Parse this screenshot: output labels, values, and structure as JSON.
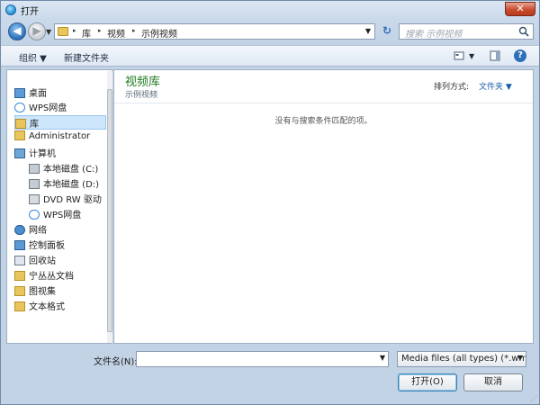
{
  "window": {
    "title": "打开",
    "close_glyph": "✕"
  },
  "nav": {
    "back_glyph": "◀",
    "forward_glyph": "▶",
    "history_glyph": "▼",
    "refresh_glyph": "↻"
  },
  "address": {
    "breadcrumbs": [
      "库",
      "视频",
      "示例视频"
    ],
    "separator": "▸",
    "drop_glyph": "▼"
  },
  "search": {
    "placeholder": "搜索 示例视频"
  },
  "toolbar": {
    "organize_label": "组织 ▼",
    "new_folder_label": "新建文件夹",
    "views_drop_glyph": "▼",
    "help_glyph": "?"
  },
  "sidebar": {
    "items": [
      {
        "label": "桌面",
        "icon": "desktop-icon"
      },
      {
        "label": "WPS网盘",
        "icon": "cloud-icon"
      },
      {
        "label": "库",
        "icon": "library-icon"
      },
      {
        "label": "Administrator",
        "icon": "user-folder-icon"
      },
      {
        "label": "计算机",
        "icon": "computer-icon"
      },
      {
        "label": "本地磁盘 (C:)",
        "icon": "drive-icon"
      },
      {
        "label": "本地磁盘 (D:)",
        "icon": "drive-icon"
      },
      {
        "label": "DVD RW 驱动",
        "icon": "dvd-icon"
      },
      {
        "label": "WPS网盘",
        "icon": "cloud-icon"
      },
      {
        "label": "网络",
        "icon": "network-icon"
      },
      {
        "label": "控制面板",
        "icon": "control-panel-icon"
      },
      {
        "label": "回收站",
        "icon": "recycle-bin-icon"
      },
      {
        "label": "宁丛丛文档",
        "icon": "folder-icon"
      },
      {
        "label": "图视集",
        "icon": "folder-icon"
      },
      {
        "label": "文本格式",
        "icon": "folder-icon"
      }
    ]
  },
  "content": {
    "library_title": "视频库",
    "library_subtitle": "示例视频",
    "arrange_label": "排列方式:",
    "arrange_value": "文件夹 ▼",
    "empty_message": "没有与搜索条件匹配的项。"
  },
  "footer": {
    "filename_label": "文件名(N):",
    "filename_value": "",
    "filename_drop_glyph": "▼",
    "filter_value": "Media files (all types) (*.wmv",
    "filter_drop_glyph": "▼",
    "open_label": "打开(O)",
    "cancel_label": "取消"
  },
  "colors": {
    "accent": "#1a5ea8",
    "library_title": "#1f7a1f",
    "close_button": "#c94b2e"
  }
}
